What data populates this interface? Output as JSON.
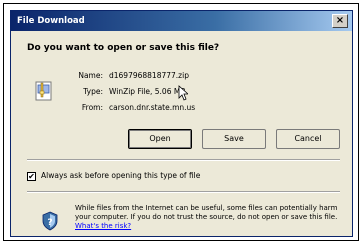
{
  "window": {
    "title": "File Download",
    "close_label": "×"
  },
  "prompt": {
    "question": "Do you want to open or save this file?"
  },
  "file_info": {
    "name_label": "Name:",
    "name_value": "d1697968818777.zip",
    "type_label": "Type:",
    "type_value": "WinZip File, 5.06 MB",
    "from_label": "From:",
    "from_value": "carson.dnr.state.mn.us"
  },
  "buttons": {
    "open_label": "Open",
    "save_label": "Save",
    "cancel_label": "Cancel"
  },
  "checkbox": {
    "checked_mark": "✔",
    "label": "Always ask before opening this type of file"
  },
  "warning": {
    "text": "While files from the Internet can be useful, some files can potentially harm your computer. If you do not trust the source, do not open or save this file.",
    "link_text": "What's the risk?"
  },
  "icons": {
    "file": "zip-file-icon",
    "shield": "shield-question-icon",
    "cursor": "mouse-pointer-icon"
  }
}
